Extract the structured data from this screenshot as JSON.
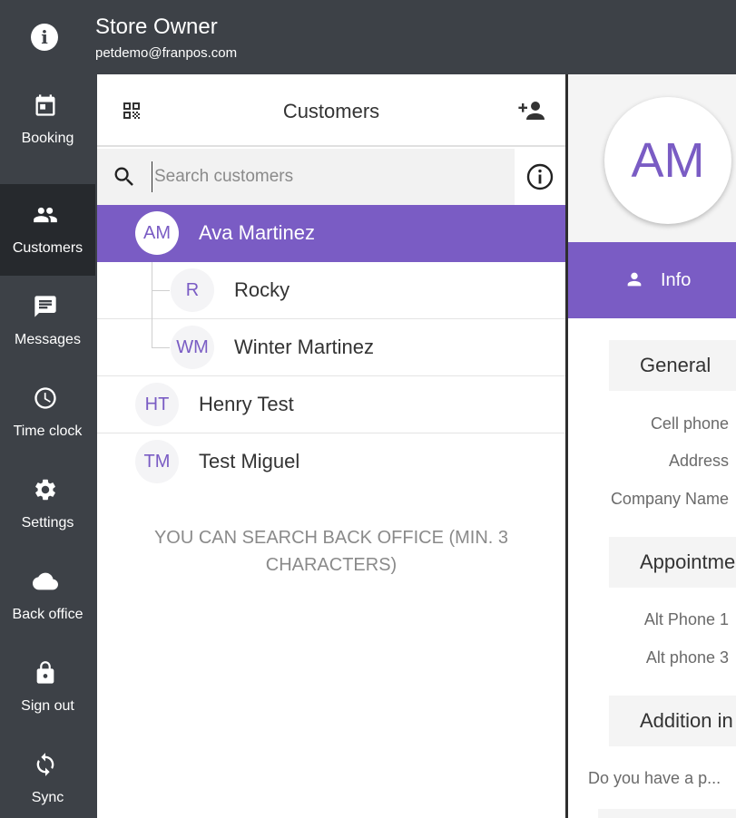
{
  "header": {
    "user_name": "Store Owner",
    "user_email": "petdemo@franpos.com",
    "info_icon": "info-icon"
  },
  "nav": {
    "items": [
      {
        "label": "Booking",
        "icon": "calendar-icon"
      },
      {
        "label": "Customers",
        "icon": "people-icon",
        "active": true
      },
      {
        "label": "Messages",
        "icon": "message-icon"
      },
      {
        "label": "Time clock",
        "icon": "clock-icon"
      },
      {
        "label": "Settings",
        "icon": "gear-icon"
      },
      {
        "label": "Back office",
        "icon": "cloud-icon"
      },
      {
        "label": "Sign out",
        "icon": "lock-icon"
      },
      {
        "label": "Sync",
        "icon": "sync-icon"
      }
    ]
  },
  "customers": {
    "title": "Customers",
    "search_placeholder": "Search customers",
    "rows": [
      {
        "initials": "AM",
        "name": "Ava Martinez",
        "selected": true
      },
      {
        "initials": "R",
        "name": "Rocky",
        "child": true
      },
      {
        "initials": "WM",
        "name": "Winter Martinez",
        "child": true
      },
      {
        "initials": "HT",
        "name": "Henry Test"
      },
      {
        "initials": "TM",
        "name": "Test Miguel"
      }
    ],
    "hint": "YOU CAN SEARCH BACK OFFICE (MIN. 3 CHARACTERS)"
  },
  "detail": {
    "initials": "AM",
    "tab_label": "Info",
    "sections": {
      "general": "General",
      "appointments": "Appointme",
      "additional": "Addition in"
    },
    "fields": {
      "cell_phone": "Cell phone",
      "address": "Address",
      "company_name": "Company Name",
      "alt_phone_1": "Alt Phone 1",
      "alt_phone_3": "Alt phone 3",
      "question": "Do you have a p..."
    }
  },
  "colors": {
    "accent": "#7a5cc4",
    "nav_bg": "#3d4147",
    "nav_active": "#26292d"
  }
}
